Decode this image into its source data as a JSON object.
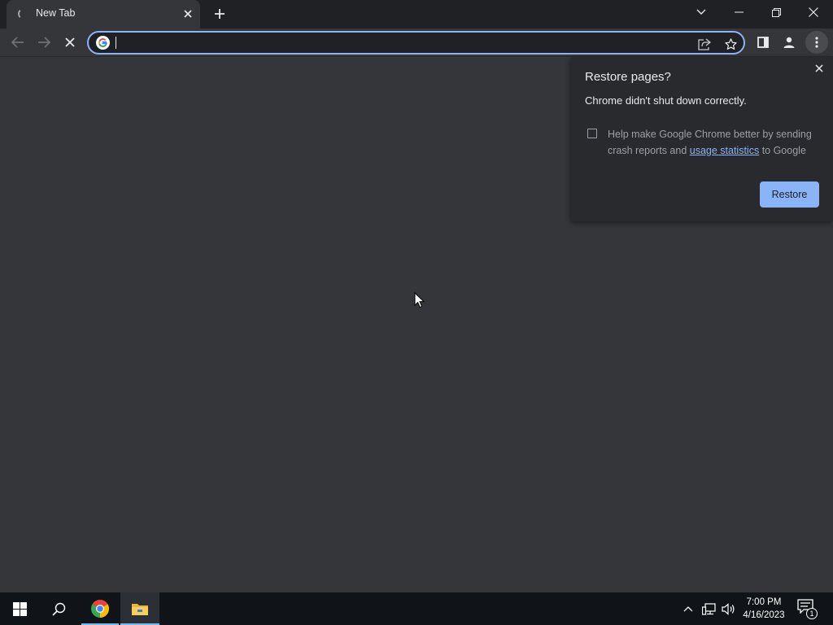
{
  "browser": {
    "tab": {
      "title": "New Tab",
      "loading": true
    },
    "omnibox": {
      "value": "",
      "placeholder": ""
    }
  },
  "restore_bubble": {
    "title": "Restore pages?",
    "message": "Chrome didn't shut down correctly.",
    "checkbox_checked": false,
    "checkbox_text_before": "Help make Google Chrome better by sending crash reports and ",
    "checkbox_link": "usage statistics",
    "checkbox_text_after": " to Google",
    "restore_label": "Restore"
  },
  "taskbar": {
    "time": "7:00 PM",
    "date": "4/16/2023",
    "notification_count": "1",
    "apps": [
      "windows-start",
      "search",
      "google-chrome",
      "file-explorer"
    ]
  },
  "colors": {
    "accent": "#8ab4f8",
    "tabstrip_bg": "#202124",
    "toolbar_bg": "#35363a",
    "bubble_bg": "#292a2d",
    "taskbar_bg": "#101418"
  }
}
